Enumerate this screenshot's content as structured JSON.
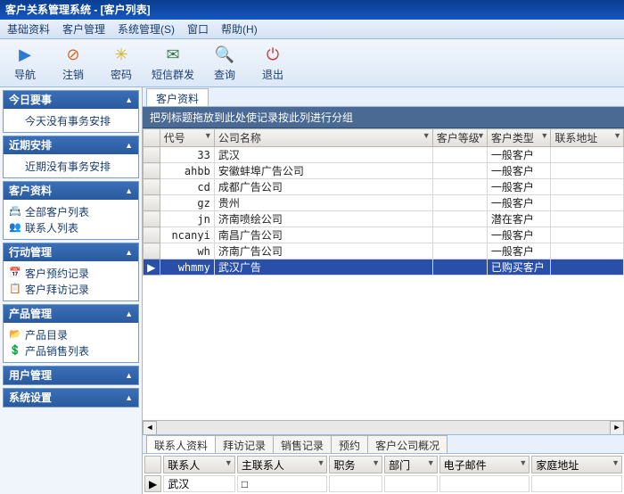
{
  "titlebar": "客户关系管理系统  -  [客户列表]",
  "menu": {
    "items": [
      "基础资料",
      "客户管理",
      "系统管理(S)",
      "窗口",
      "帮助(H)"
    ]
  },
  "toolbar": {
    "items": [
      {
        "icon": "▶",
        "label": "导航",
        "color": "#2a7ad6"
      },
      {
        "icon": "⊘",
        "label": "注销",
        "color": "#d06a2a"
      },
      {
        "icon": "✳",
        "label": "密码",
        "color": "#d6b22a"
      },
      {
        "icon": "✉",
        "label": "短信群发",
        "color": "#3a7a4a"
      },
      {
        "icon": "🔍",
        "label": "查询",
        "color": "#3a7a4a"
      },
      {
        "icon": "⏻",
        "label": "退出",
        "color": "#c23a3a"
      }
    ]
  },
  "sidebar": {
    "panels": [
      {
        "title": "今日要事",
        "items": [
          {
            "icon": "",
            "label": "今天没有事务安排"
          }
        ]
      },
      {
        "title": "近期安排",
        "items": [
          {
            "icon": "",
            "label": "近期没有事务安排"
          }
        ]
      },
      {
        "title": "客户资料",
        "items": [
          {
            "icon": "📇",
            "label": "全部客户列表"
          },
          {
            "icon": "👥",
            "label": "联系人列表"
          }
        ]
      },
      {
        "title": "行动管理",
        "items": [
          {
            "icon": "📅",
            "label": "客户预约记录"
          },
          {
            "icon": "📋",
            "label": "客户拜访记录"
          }
        ]
      },
      {
        "title": "产品管理",
        "items": [
          {
            "icon": "📂",
            "label": "产品目录"
          },
          {
            "icon": "💲",
            "label": "产品销售列表"
          }
        ]
      },
      {
        "title": "用户管理",
        "items": []
      },
      {
        "title": "系统设置",
        "items": []
      }
    ]
  },
  "content": {
    "tab": "客户资料",
    "group_hint": "把列标题拖放到此处使记录按此列进行分组",
    "columns": [
      "代号",
      "公司名称",
      "客户等级",
      "客户类型",
      "联系地址"
    ],
    "rows": [
      {
        "code": "33",
        "name": "武汉",
        "level": "",
        "type": "一般客户"
      },
      {
        "code": "ahbb",
        "name": "安徽蚌埠广告公司",
        "level": "",
        "type": "一般客户"
      },
      {
        "code": "cd",
        "name": "成都广告公司",
        "level": "",
        "type": "一般客户"
      },
      {
        "code": "gz",
        "name": "贵州",
        "level": "",
        "type": "一般客户"
      },
      {
        "code": "jn",
        "name": "济南喷绘公司",
        "level": "",
        "type": "潜在客户"
      },
      {
        "code": "ncanyi",
        "name": "南昌广告公司",
        "level": "",
        "type": "一般客户"
      },
      {
        "code": "wh",
        "name": "济南广告公司",
        "level": "",
        "type": "一般客户"
      },
      {
        "code": "whmmy",
        "name": "武汉广告",
        "level": "",
        "type": "已购买客户",
        "selected": true
      }
    ],
    "bottom_tabs": [
      "联系人资料",
      "拜访记录",
      "销售记录",
      "预约",
      "客户公司概况"
    ],
    "sub_columns": [
      "联系人",
      "主联系人",
      "职务",
      "部门",
      "电子邮件",
      "家庭地址"
    ],
    "sub_rows": [
      {
        "contact": "武汉",
        "main": "□",
        "job": "",
        "dept": "",
        "email": "",
        "home": ""
      }
    ]
  }
}
